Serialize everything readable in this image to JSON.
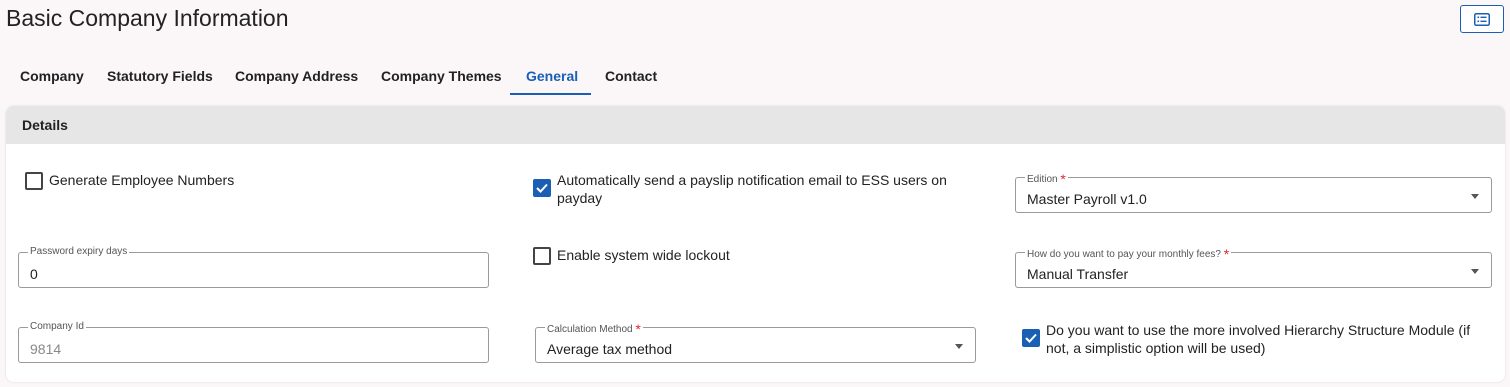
{
  "header": {
    "title": "Basic Company Information",
    "corner_icon": "list-view-icon"
  },
  "tabs": [
    {
      "label": "Company"
    },
    {
      "label": "Statutory Fields"
    },
    {
      "label": "Company Address"
    },
    {
      "label": "Company Themes"
    },
    {
      "label": "General",
      "active": true
    },
    {
      "label": "Contact"
    }
  ],
  "details": {
    "heading": "Details",
    "generate_employee_numbers": {
      "label": "Generate Employee Numbers",
      "checked": false
    },
    "payslip_email": {
      "label_line1": "Automatically send a payslip notification email to ESS users on",
      "label_line2": "payday",
      "checked": true
    },
    "edition": {
      "label": "Edition",
      "required": "*",
      "value": "Master Payroll v1.0"
    },
    "password_expiry": {
      "label": "Password expiry days",
      "value": "0"
    },
    "system_lockout": {
      "label": "Enable system wide lockout",
      "checked": false
    },
    "monthly_fees": {
      "label": "How do you want to pay your monthly fees?",
      "required": "*",
      "value": "Manual Transfer"
    },
    "company_id": {
      "label": "Company Id",
      "value": "9814"
    },
    "calculation_method": {
      "label": "Calculation Method",
      "required": "*",
      "value": "Average tax method"
    },
    "hierarchy_module": {
      "label_line1": "Do you want to use the more involved Hierarchy Structure Module (if",
      "label_line2": "not, a simplistic option will be used)",
      "checked": true
    }
  },
  "colors": {
    "accent": "#1a5fb4",
    "required": "#e0282b",
    "header_bg": "#e6e6e6"
  }
}
